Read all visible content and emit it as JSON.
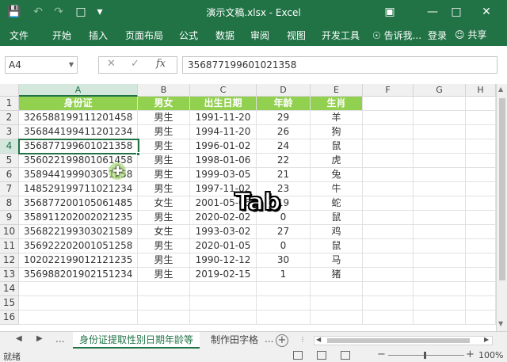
{
  "window": {
    "title": "演示文稿.xlsx - Excel"
  },
  "ribbon": {
    "tabs": [
      "文件",
      "开始",
      "插入",
      "页面布局",
      "公式",
      "数据",
      "审阅",
      "视图",
      "开发工具"
    ],
    "tell_me": "告诉我...",
    "login": "登录",
    "share": "共享"
  },
  "formula_bar": {
    "name_box": "A4",
    "fx_label": "fx",
    "value": "356877199601021358"
  },
  "columns": [
    "A",
    "B",
    "C",
    "D",
    "E",
    "F",
    "G",
    "H"
  ],
  "rows": [
    "1",
    "2",
    "3",
    "4",
    "5",
    "6",
    "7",
    "8",
    "9",
    "10",
    "11",
    "12",
    "13",
    "14",
    "15",
    "16"
  ],
  "sheet": {
    "header": [
      "身份证",
      "男女",
      "出生日期",
      "年龄",
      "生肖"
    ],
    "data": [
      [
        "326588199111201458",
        "男生",
        "1991-11-20",
        "29",
        "羊"
      ],
      [
        "356844199411201234",
        "男生",
        "1994-11-20",
        "26",
        "狗"
      ],
      [
        "356877199601021358",
        "男生",
        "1996-01-02",
        "24",
        "鼠"
      ],
      [
        "356022199801061458",
        "男生",
        "1998-01-06",
        "22",
        "虎"
      ],
      [
        "358944199903051258",
        "男生",
        "1999-03-05",
        "21",
        "兔"
      ],
      [
        "148529199711021234",
        "男生",
        "1997-11-02",
        "23",
        "牛"
      ],
      [
        "356877200105061485",
        "女生",
        "2001-05-06",
        "19",
        "蛇"
      ],
      [
        "358911202002021235",
        "男生",
        "2020-02-02",
        "0",
        "鼠"
      ],
      [
        "356822199303021589",
        "女生",
        "1993-03-02",
        "27",
        "鸡"
      ],
      [
        "356922202001051258",
        "男生",
        "2020-01-05",
        "0",
        "鼠"
      ],
      [
        "102022199012121235",
        "男生",
        "1990-12-12",
        "30",
        "马"
      ],
      [
        "356988201902151234",
        "男生",
        "2019-02-15",
        "1",
        "猪"
      ]
    ]
  },
  "overlay": {
    "key_label": "Tab"
  },
  "sheet_tabs": {
    "ellipsis": "...",
    "active": "身份证提取性别日期年龄等",
    "other": "制作田字格"
  },
  "status": {
    "text": "就绪",
    "zoom": "100%"
  },
  "colors": {
    "excel_green": "#217346",
    "header_fill": "#92d050"
  }
}
